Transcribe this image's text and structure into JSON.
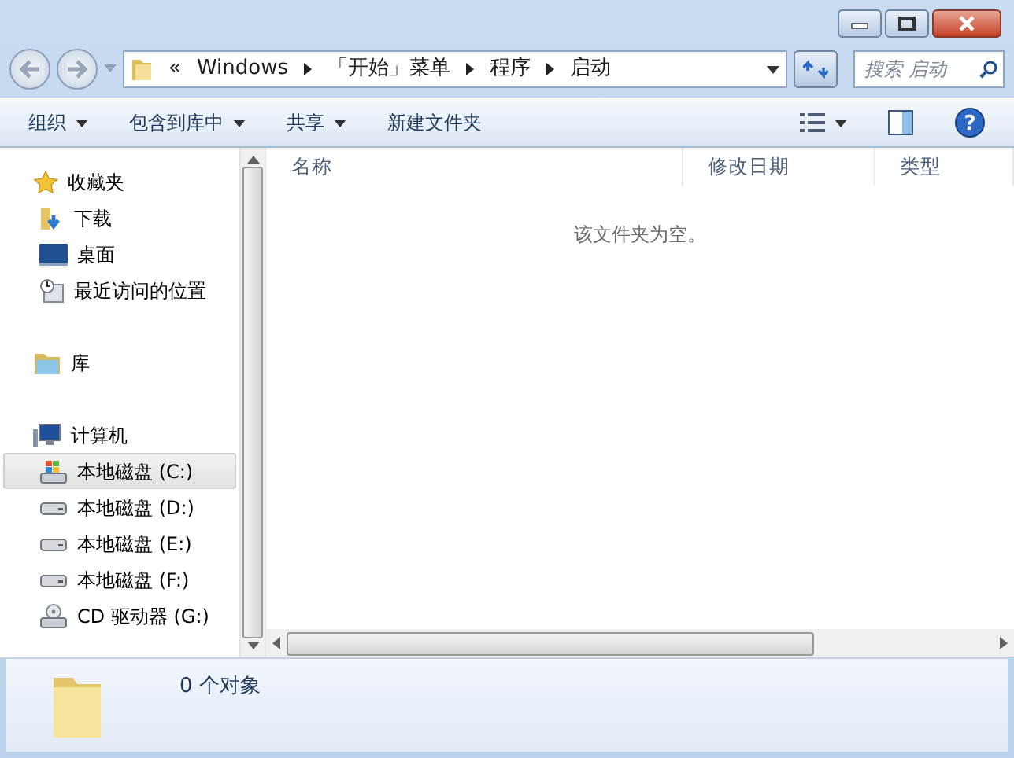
{
  "address_bar": {
    "segments": [
      "«",
      "Windows",
      "「开始」菜单",
      "程序",
      "启动"
    ]
  },
  "search": {
    "placeholder": "搜索 启动"
  },
  "toolbar": [
    {
      "label": "组织",
      "dropdown": true
    },
    {
      "label": "包含到库中",
      "dropdown": true
    },
    {
      "label": "共享",
      "dropdown": true
    },
    {
      "label": "新建文件夹",
      "dropdown": false
    }
  ],
  "navigation": [
    {
      "label": "收藏夹",
      "kind": "star",
      "selected": false,
      "children": [
        {
          "label": "下载",
          "kind": "download",
          "selected": false
        },
        {
          "label": "桌面",
          "kind": "desktop",
          "selected": false
        },
        {
          "label": "最近访问的位置",
          "kind": "recent",
          "selected": false
        }
      ]
    },
    {
      "label": "库",
      "kind": "library",
      "selected": false
    },
    {
      "label": "计算机",
      "kind": "computer",
      "selected": false,
      "children": [
        {
          "label": "本地磁盘 (C:)",
          "kind": "system-drive",
          "selected": true
        },
        {
          "label": "本地磁盘 (D:)",
          "kind": "drive",
          "selected": false
        },
        {
          "label": "本地磁盘 (E:)",
          "kind": "drive",
          "selected": false
        },
        {
          "label": "本地磁盘 (F:)",
          "kind": "drive",
          "selected": false
        },
        {
          "label": "CD 驱动器 (G:)",
          "kind": "cd",
          "selected": false
        }
      ]
    }
  ],
  "table": {
    "columns": [
      "名称",
      "修改日期",
      "类型"
    ],
    "empty_message": "该文件夹为空。"
  },
  "help_button": {
    "label": "?"
  },
  "status_bar": {
    "text": "0 个对象"
  }
}
